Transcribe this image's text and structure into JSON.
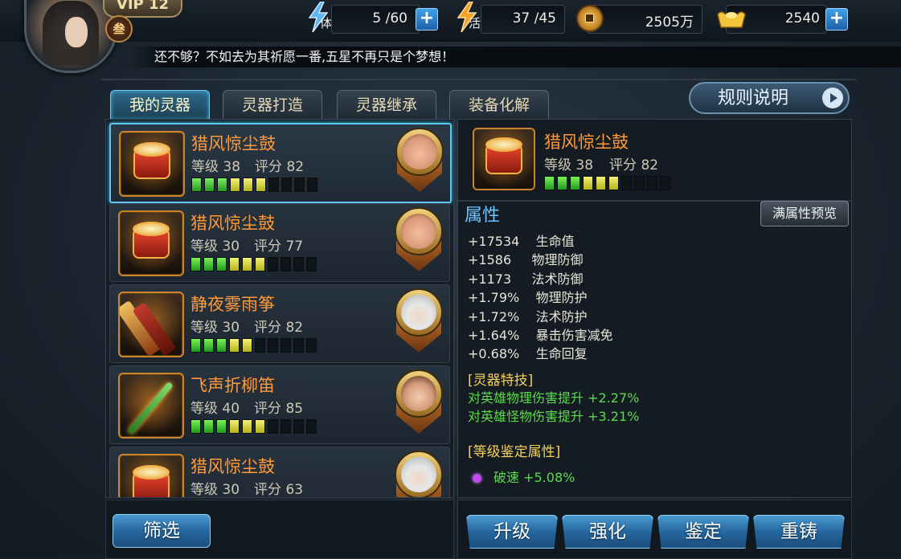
{
  "player": {
    "vip": "VIP 12",
    "rank_glyph": "叁"
  },
  "resources": {
    "stamina": {
      "label": "体",
      "value": "5 /60"
    },
    "vitality": {
      "label": "活",
      "value": "37 /45"
    },
    "copper": {
      "value": "2505万"
    },
    "gold": {
      "value": "2540"
    }
  },
  "ticker": "还不够？不如去为其祈愿一番,五星不再只是个梦想！",
  "tabs": [
    {
      "label": "我的灵器",
      "active": true
    },
    {
      "label": "灵器打造",
      "active": false
    },
    {
      "label": "灵器继承",
      "active": false
    },
    {
      "label": "装备化解",
      "active": false
    }
  ],
  "rules_button": "规则说明",
  "items": [
    {
      "name": "猎风惊尘鼓",
      "level": "等级 38",
      "score": "评分 82",
      "pips": [
        "g",
        "g",
        "g",
        "y",
        "y",
        "y",
        "n",
        "n",
        "n",
        "n"
      ],
      "icon": "drum",
      "hero": "pig",
      "selected": true
    },
    {
      "name": "猎风惊尘鼓",
      "level": "等级 30",
      "score": "评分 77",
      "pips": [
        "g",
        "g",
        "g",
        "y",
        "y",
        "y",
        "n",
        "n",
        "n",
        "n"
      ],
      "icon": "drum",
      "hero": "pig",
      "selected": false
    },
    {
      "name": "静夜雾雨筝",
      "level": "等级 30",
      "score": "评分 82",
      "pips": [
        "g",
        "g",
        "g",
        "y",
        "y",
        "n",
        "n",
        "n",
        "n",
        "n"
      ],
      "icon": "zither",
      "hero": "white-hair",
      "selected": false
    },
    {
      "name": "飞声折柳笛",
      "level": "等级 40",
      "score": "评分 85",
      "pips": [
        "g",
        "g",
        "g",
        "y",
        "y",
        "y",
        "n",
        "n",
        "n",
        "n"
      ],
      "icon": "flute",
      "hero": "woman",
      "selected": false
    },
    {
      "name": "猎风惊尘鼓",
      "level": "等级 30",
      "score": "评分 63",
      "pips": [
        "g",
        "g",
        "g",
        "y",
        "y",
        "n",
        "n",
        "n",
        "n",
        "n"
      ],
      "icon": "drum",
      "hero": "white-hair",
      "selected": false
    }
  ],
  "detail": {
    "name": "猎风惊尘鼓",
    "level": "等级 38",
    "score": "评分 82",
    "pips": [
      "g",
      "g",
      "g",
      "y",
      "y",
      "y",
      "n",
      "n",
      "n",
      "n"
    ],
    "attr_title": "属性",
    "preview_button": "满属性预览",
    "attributes": [
      "+17534    生命值",
      "+1586     物理防御",
      "+1173     法术防御",
      "+1.79%    物理防护",
      "+1.72%    法术防护",
      "+1.64%    暴击伤害减免",
      "+0.68%    生命回复"
    ],
    "skill_title": "[灵器特技]",
    "skills": [
      "对英雄物理伤害提升 +2.27%",
      "对英雄怪物伤害提升 +3.21%"
    ],
    "appraisal_title": "[等级鉴定属性]",
    "appraisal": [
      "破速 +5.08%"
    ]
  },
  "buttons": {
    "filter": "筛选",
    "upgrade": "升级",
    "enhance": "强化",
    "appraise": "鉴定",
    "recast": "重铸"
  }
}
